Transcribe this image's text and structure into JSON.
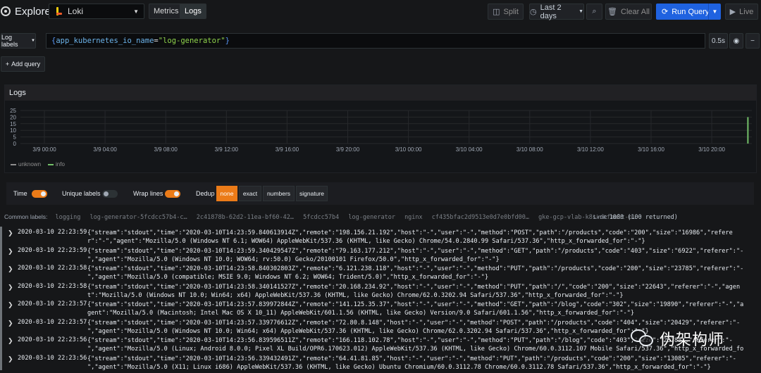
{
  "header": {
    "title": "Explore",
    "datasource": "Loki",
    "mode_metrics": "Metrics",
    "mode_logs": "Logs",
    "split_label": "Split",
    "time_range": "Last 2 days",
    "clear_all": "Clear All",
    "run_query": "Run Query",
    "live": "Live"
  },
  "query": {
    "log_labels_btn": "Log labels",
    "brace_open": "{",
    "key": "app_kubernetes_io_name",
    "op": "=",
    "value": "\"log-generator\"",
    "brace_close": "}",
    "time": "0.5s",
    "add_query": "Add query"
  },
  "logs_panel": {
    "title": "Logs"
  },
  "chart_data": {
    "type": "bar",
    "y_ticks": [
      "25",
      "20",
      "15",
      "10",
      "5",
      "0"
    ],
    "ylim": [
      0,
      25
    ],
    "x_ticks": [
      "3/9 00:00",
      "3/9 04:00",
      "3/9 08:00",
      "3/9 12:00",
      "3/9 16:00",
      "3/9 20:00",
      "3/10 00:00",
      "3/10 04:00",
      "3/10 08:00",
      "3/10 12:00",
      "3/10 16:00",
      "3/10 20:00"
    ],
    "series": [
      {
        "name": "unknown",
        "color": "#8e8e8e"
      },
      {
        "name": "info",
        "color": "#73bf69"
      }
    ],
    "spike": {
      "x": "3/10 22:23",
      "value": 20,
      "series": "info"
    },
    "grid": true,
    "legend_placement": "bottom-left"
  },
  "options": {
    "time_label": "Time",
    "time_on": true,
    "unique_labels_label": "Unique labels",
    "unique_labels_on": false,
    "wrap_lines_label": "Wrap lines",
    "wrap_lines_on": true,
    "dedup_label": "Dedup",
    "dedup_none": "none",
    "dedup_exact": "exact",
    "dedup_numbers": "numbers",
    "dedup_signature": "signature"
  },
  "common_labels": {
    "title": "Common labels:",
    "values": [
      "logging",
      "log-generator-5fcdcc57b4-c…",
      "2c41878b-62d2-11ea-bf60-42…",
      "5fcdcc57b4",
      "log-generator",
      "nginx",
      "cf435bfac2d9513e0d7e0bfd00…",
      "gke-gcp-vlab-k8s-default-p…"
    ],
    "limit_label": "Limit:",
    "limit_value": "1000 (100 returned)"
  },
  "log_rows": [
    {
      "ts": "2020-03-10 22:23:59",
      "line": "{\"stream\":\"stdout\",\"time\":\"2020-03-10T14:23:59.840613914Z\",\"remote\":\"198.156.21.192\",\"host\":\"-\",\"user\":\"-\",\"method\":\"POST\",\"path\":\"/products\",\"code\":\"200\",\"size\":\"16986\",\"referer\":\"-\",\"agent\":\"Mozilla/5.0 (Windows NT 6.1; WOW64) AppleWebKit/537.36 (KHTML, like Gecko) Chrome/54.0.2840.99 Safari/537.36\",\"http_x_forwarded_for\":\"-\"}"
    },
    {
      "ts": "2020-03-10 22:23:59",
      "line": "{\"stream\":\"stdout\",\"time\":\"2020-03-10T14:23:59.340429547Z\",\"remote\":\"79.163.177.212\",\"host\":\"-\",\"user\":\"-\",\"method\":\"GET\",\"path\":\"/products\",\"code\":\"403\",\"size\":\"6922\",\"referer\":\"-\",\"agent\":\"Mozilla/5.0 (Windows NT 10.0; WOW64; rv:50.0) Gecko/20100101 Firefox/50.0\",\"http_x_forwarded_for\":\"-\"}"
    },
    {
      "ts": "2020-03-10 22:23:58",
      "line": "{\"stream\":\"stdout\",\"time\":\"2020-03-10T14:23:58.840302803Z\",\"remote\":\"6.121.238.118\",\"host\":\"-\",\"user\":\"-\",\"method\":\"PUT\",\"path\":\"/products\",\"code\":\"200\",\"size\":\"23785\",\"referer\":\"-\",\"agent\":\"Mozilla/5.0 (compatible; MSIE 9.0; Windows NT 6.2; WOW64; Trident/5.0)\",\"http_x_forwarded_for\":\"-\"}"
    },
    {
      "ts": "2020-03-10 22:23:58",
      "line": "{\"stream\":\"stdout\",\"time\":\"2020-03-10T14:23:58.340141527Z\",\"remote\":\"20.168.234.92\",\"host\":\"-\",\"user\":\"-\",\"method\":\"PUT\",\"path\":\"/\",\"code\":\"200\",\"size\":\"22643\",\"referer\":\"-\",\"agent\":\"Mozilla/5.0 (Windows NT 10.0; Win64; x64) AppleWebKit/537.36 (KHTML, like Gecko) Chrome/62.0.3202.94 Safari/537.36\",\"http_x_forwarded_for\":\"-\"}"
    },
    {
      "ts": "2020-03-10 22:23:57",
      "line": "{\"stream\":\"stdout\",\"time\":\"2020-03-10T14:23:57.839972844Z\",\"remote\":\"141.125.35.37\",\"host\":\"-\",\"user\":\"-\",\"method\":\"GET\",\"path\":\"/blog\",\"code\":\"302\",\"size\":\"19890\",\"referer\":\"-\",\"agent\":\"Mozilla/5.0 (Macintosh; Intel Mac OS X 10_11) AppleWebKit/601.1.56 (KHTML, like Gecko) Version/9.0 Safari/601.1.56\",\"http_x_forwarded_for\":\"-\"}"
    },
    {
      "ts": "2020-03-10 22:23:57",
      "line": "{\"stream\":\"stdout\",\"time\":\"2020-03-10T14:23:57.339776612Z\",\"remote\":\"72.80.8.148\",\"host\":\"-\",\"user\":\"-\",\"method\":\"POST\",\"path\":\"/products\",\"code\":\"404\",\"size\":\"20429\",\"referer\":\"-\",\"agent\":\"Mozilla/5.0 (Windows NT 10.0; Win64; x64) AppleWebKit/537.36 (KHTML, like Gecko) Chrome/62.0.3202.94 Safari/537.36\",\"http_x_forwarded_for\":\"-\"}"
    },
    {
      "ts": "2020-03-10 22:23:56",
      "line": "{\"stream\":\"stdout\",\"time\":\"2020-03-10T14:23:56.839596511Z\",\"remote\":\"166.118.102.78\",\"host\":\"-\",\"user\":\"-\",\"method\":\"PUT\",\"path\":\"/blog\",\"code\":\"403\",\"size\":\"23785\",\"referer\":\"-\",\"agent\":\"Mozilla/5.0 (Linux; Android 8.0.0; Pixel XL Build/OPR6.170623.012) AppleWebKit/537.36 (KHTML, like Gecko) Chrome/60.0.3112.107 Mobile Safari/537.36\",\"http_x_forwarded_for\":\"-\"}"
    },
    {
      "ts": "2020-03-10 22:23:56",
      "line": "{\"stream\":\"stdout\",\"time\":\"2020-03-10T14:23:56.339432491Z\",\"remote\":\"64.41.81.85\",\"host\":\"-\",\"user\":\"-\",\"method\":\"PUT\",\"path\":\"/products\",\"code\":\"200\",\"size\":\"13085\",\"referer\":\"-\",\"agent\":\"Mozilla/5.0 (X11; Linux i686) AppleWebKit/537.36 (KHTML, like Gecko) Ubuntu Chromium/60.0.3112.78 Chrome/60.0.3112.78 Safari/537.36\",\"http_x_forwarded_for\":\"-\"}"
    }
  ],
  "watermark": {
    "text": "伪架构师"
  }
}
